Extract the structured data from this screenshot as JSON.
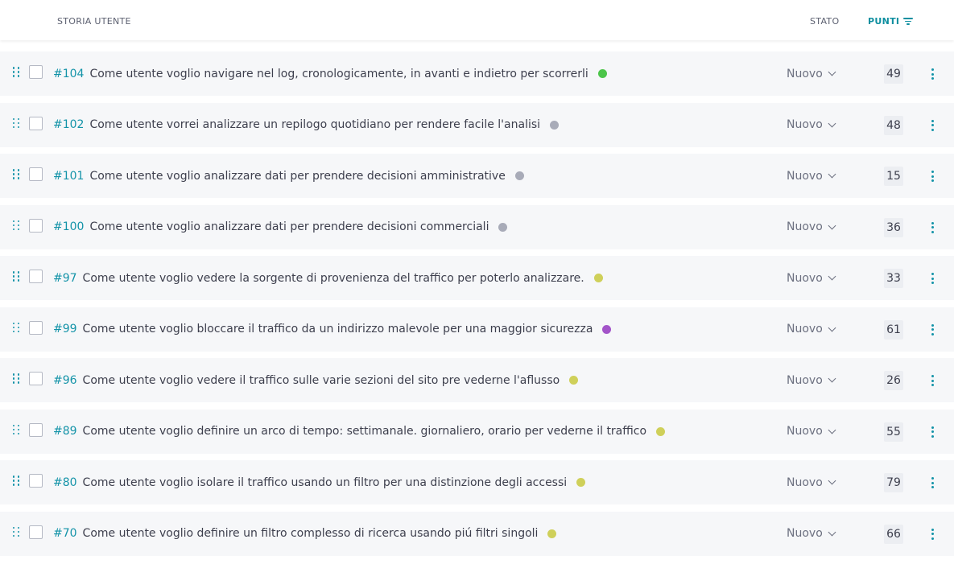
{
  "header": {
    "story_label": "STORIA UTENTE",
    "status_label": "STATO",
    "points_label": "PUNTI"
  },
  "colors": {
    "accent": "#1393a8",
    "green": "#4cc54a",
    "gray": "#a8abb8",
    "yellow": "#cfd05a",
    "purple": "#a354c9"
  },
  "stories": [
    {
      "ref": "#104",
      "subject": "Come utente voglio navigare nel log, cronologicamente, in avanti e indietro per scorrerli",
      "status": "Nuovo",
      "points": "49",
      "color": "#4cc54a"
    },
    {
      "ref": "#102",
      "subject": "Come utente vorrei analizzare un repilogo quotidiano per rendere facile l'analisi",
      "status": "Nuovo",
      "points": "48",
      "color": "#a8abb8"
    },
    {
      "ref": "#101",
      "subject": "Come utente voglio analizzare dati per prendere decisioni amministrative",
      "status": "Nuovo",
      "points": "15",
      "color": "#a8abb8"
    },
    {
      "ref": "#100",
      "subject": "Come utente voglio analizzare dati per prendere decisioni commerciali",
      "status": "Nuovo",
      "points": "36",
      "color": "#a8abb8"
    },
    {
      "ref": "#97",
      "subject": "Come utente voglio vedere la sorgente di provenienza del traffico per poterlo analizzare.",
      "status": "Nuovo",
      "points": "33",
      "color": "#cfd05a"
    },
    {
      "ref": "#99",
      "subject": "Come utente voglio bloccare il traffico da un indirizzo malevole per una maggior sicurezza",
      "status": "Nuovo",
      "points": "61",
      "color": "#a354c9"
    },
    {
      "ref": "#96",
      "subject": "Come utente voglio vedere il traffico sulle varie sezioni del sito pre vederne l'aflusso",
      "status": "Nuovo",
      "points": "26",
      "color": "#cfd05a"
    },
    {
      "ref": "#89",
      "subject": "Come utente voglio definire un arco di tempo: settimanale. giornaliero, orario per vederne il traffico",
      "status": "Nuovo",
      "points": "55",
      "color": "#cfd05a"
    },
    {
      "ref": "#80",
      "subject": "Come utente voglio isolare il traffico usando un filtro per una distinzione degli accessi",
      "status": "Nuovo",
      "points": "79",
      "color": "#cfd05a"
    },
    {
      "ref": "#70",
      "subject": "Come utente voglio definire un filtro complesso di ricerca usando piú filtri singoli",
      "status": "Nuovo",
      "points": "66",
      "color": "#cfd05a"
    }
  ]
}
